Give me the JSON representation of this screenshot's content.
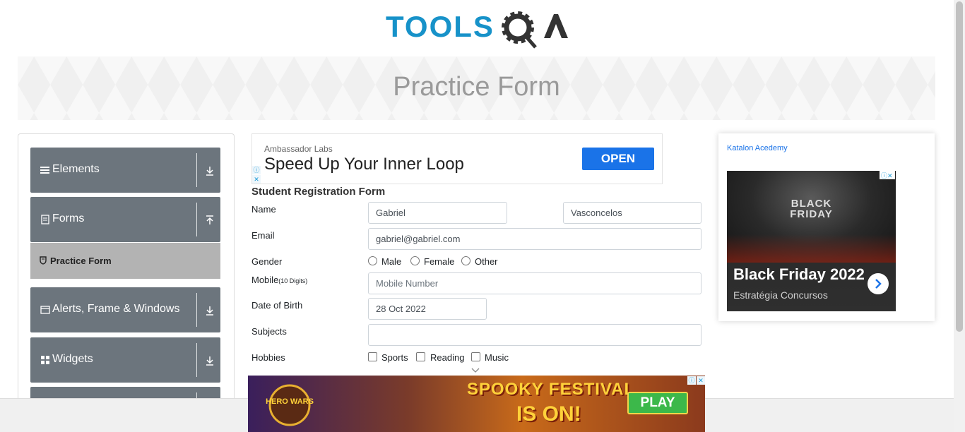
{
  "header": {
    "title": "Practice Form"
  },
  "sidebar": {
    "groups": [
      {
        "label": "Elements"
      },
      {
        "label": "Forms"
      },
      {
        "label": "Alerts, Frame & Windows"
      },
      {
        "label": "Widgets"
      }
    ],
    "active_item": "Practice Form"
  },
  "ad_top": {
    "sponsor": "Ambassador Labs",
    "headline": "Speed Up Your Inner Loop",
    "cta": "OPEN"
  },
  "form": {
    "title": "Student Registration Form",
    "labels": {
      "name": "Name",
      "email": "Email",
      "gender": "Gender",
      "mobile": "Mobile",
      "mobile_hint": "(10 Digits)",
      "dob": "Date of Birth",
      "subjects": "Subjects",
      "hobbies": "Hobbies"
    },
    "first_name": "Gabriel",
    "last_name": "Vasconcelos",
    "email": "gabriel@gabriel.com",
    "mobile_placeholder": "Mobile Number",
    "dob": "28 Oct 2022",
    "subjects": "",
    "gender_options": [
      "Male",
      "Female",
      "Other"
    ],
    "hobby_options": [
      "Sports",
      "Reading",
      "Music"
    ]
  },
  "ad_right": {
    "broken_image_alt": "Katalon Acedemy",
    "art_line1": "BLACK",
    "art_line2": "FRIDAY",
    "title": "Black Friday 2022",
    "subtitle": "Estratégia Concursos"
  },
  "ad_bottom": {
    "brand": "HERO WARS",
    "line1": "SPOOKY FESTIVAL",
    "line2": "IS ON!",
    "cta": "PLAY"
  },
  "colors": {
    "nav_bg": "#6c757d",
    "active_bg": "#b3b3b3",
    "open_btn": "#1a73e8",
    "logo_blue": "#1792c9",
    "logo_dark": "#333333"
  }
}
